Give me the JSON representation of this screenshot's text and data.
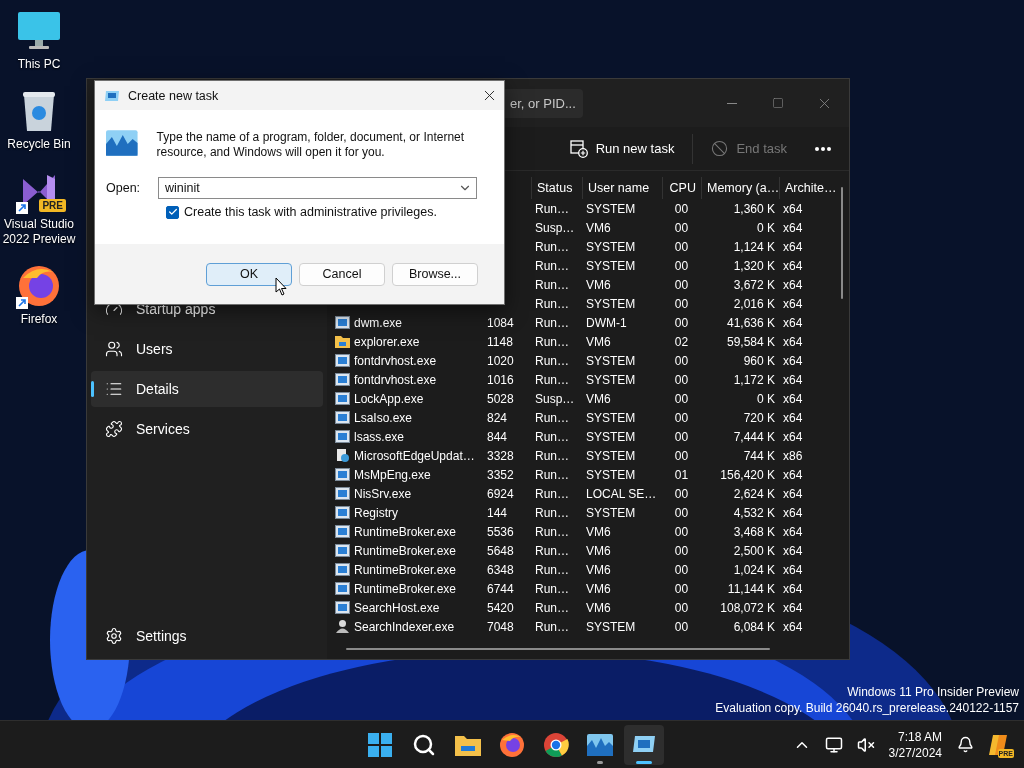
{
  "desktop": {
    "icons": [
      {
        "label": "This PC",
        "kind": "monitor"
      },
      {
        "label": "Recycle Bin",
        "kind": "bin"
      },
      {
        "label": "Visual Studio 2022 Preview",
        "kind": "vs",
        "badge": "PRE",
        "shortcut": true
      },
      {
        "label": "Firefox",
        "kind": "firefox",
        "shortcut": true
      }
    ],
    "watermark": [
      "Windows 11 Pro Insider Preview",
      "Evaluation copy. Build 26040.rs_prerelease.240122-1157"
    ]
  },
  "task_manager": {
    "search": {
      "placeholder": "er, or PID..."
    },
    "sidebar": {
      "items": [
        {
          "label": "Startup apps",
          "kind": "startup",
          "selected": false
        },
        {
          "label": "Users",
          "kind": "users",
          "selected": false
        },
        {
          "label": "Details",
          "kind": "details",
          "selected": true
        },
        {
          "label": "Services",
          "kind": "services",
          "selected": false
        }
      ],
      "footer": {
        "label": "Settings"
      }
    },
    "toolbar": [
      {
        "label": "Run new task",
        "kind": "run",
        "disabled": false
      },
      {
        "label": "End task",
        "kind": "end",
        "disabled": true
      }
    ],
    "table": {
      "columns": [
        "Status",
        "User name",
        "CPU",
        "Memory (a…",
        "Archite…"
      ],
      "rows": [
        {
          "status": "Run…",
          "user": "SYSTEM",
          "cpu": "00",
          "memory": "1,360 K",
          "arch": "x64"
        },
        {
          "status": "Susp…",
          "user": "VM6",
          "cpu": "00",
          "memory": "0 K",
          "arch": "x64"
        },
        {
          "status": "Run…",
          "user": "SYSTEM",
          "cpu": "00",
          "memory": "1,124 K",
          "arch": "x64"
        },
        {
          "status": "Run…",
          "user": "SYSTEM",
          "cpu": "00",
          "memory": "1,320 K",
          "arch": "x64"
        },
        {
          "status": "Run…",
          "user": "VM6",
          "cpu": "00",
          "memory": "3,672 K",
          "arch": "x64"
        },
        {
          "status": "Run…",
          "user": "SYSTEM",
          "cpu": "00",
          "memory": "2,016 K",
          "arch": "x64"
        },
        {
          "kind": "app",
          "name": "dwm.exe",
          "pid": "1084",
          "status": "Run…",
          "user": "DWM-1",
          "cpu": "00",
          "memory": "41,636 K",
          "arch": "x64"
        },
        {
          "kind": "folder",
          "name": "explorer.exe",
          "pid": "1148",
          "status": "Run…",
          "user": "VM6",
          "cpu": "02",
          "memory": "59,584 K",
          "arch": "x64"
        },
        {
          "kind": "app",
          "name": "fontdrvhost.exe",
          "pid": "1020",
          "status": "Run…",
          "user": "SYSTEM",
          "cpu": "00",
          "memory": "960 K",
          "arch": "x64"
        },
        {
          "kind": "app",
          "name": "fontdrvhost.exe",
          "pid": "1016",
          "status": "Run…",
          "user": "SYSTEM",
          "cpu": "00",
          "memory": "1,172 K",
          "arch": "x64"
        },
        {
          "kind": "app",
          "name": "LockApp.exe",
          "pid": "5028",
          "status": "Susp…",
          "user": "VM6",
          "cpu": "00",
          "memory": "0 K",
          "arch": "x64"
        },
        {
          "kind": "app",
          "name": "LsaIso.exe",
          "pid": "824",
          "status": "Run…",
          "user": "SYSTEM",
          "cpu": "00",
          "memory": "720 K",
          "arch": "x64"
        },
        {
          "kind": "app",
          "name": "lsass.exe",
          "pid": "844",
          "status": "Run…",
          "user": "SYSTEM",
          "cpu": "00",
          "memory": "7,444 K",
          "arch": "x64"
        },
        {
          "kind": "updater",
          "name": "MicrosoftEdgeUpdat…",
          "pid": "3328",
          "status": "Run…",
          "user": "SYSTEM",
          "cpu": "00",
          "memory": "744 K",
          "arch": "x86"
        },
        {
          "kind": "app",
          "name": "MsMpEng.exe",
          "pid": "3352",
          "status": "Run…",
          "user": "SYSTEM",
          "cpu": "01",
          "memory": "156,420 K",
          "arch": "x64"
        },
        {
          "kind": "app",
          "name": "NisSrv.exe",
          "pid": "6924",
          "status": "Run…",
          "user": "LOCAL SE…",
          "cpu": "00",
          "memory": "2,624 K",
          "arch": "x64"
        },
        {
          "kind": "app",
          "name": "Registry",
          "pid": "144",
          "status": "Run…",
          "user": "SYSTEM",
          "cpu": "00",
          "memory": "4,532 K",
          "arch": "x64"
        },
        {
          "kind": "app",
          "name": "RuntimeBroker.exe",
          "pid": "5536",
          "status": "Run…",
          "user": "VM6",
          "cpu": "00",
          "memory": "3,468 K",
          "arch": "x64"
        },
        {
          "kind": "app",
          "name": "RuntimeBroker.exe",
          "pid": "5648",
          "status": "Run…",
          "user": "VM6",
          "cpu": "00",
          "memory": "2,500 K",
          "arch": "x64"
        },
        {
          "kind": "app",
          "name": "RuntimeBroker.exe",
          "pid": "6348",
          "status": "Run…",
          "user": "VM6",
          "cpu": "00",
          "memory": "1,024 K",
          "arch": "x64"
        },
        {
          "kind": "app",
          "name": "RuntimeBroker.exe",
          "pid": "6744",
          "status": "Run…",
          "user": "VM6",
          "cpu": "00",
          "memory": "11,144 K",
          "arch": "x64"
        },
        {
          "kind": "app",
          "name": "SearchHost.exe",
          "pid": "5420",
          "status": "Run…",
          "user": "VM6",
          "cpu": "00",
          "memory": "108,072 K",
          "arch": "x64"
        },
        {
          "kind": "person",
          "name": "SearchIndexer.exe",
          "pid": "7048",
          "status": "Run…",
          "user": "SYSTEM",
          "cpu": "00",
          "memory": "6,084 K",
          "arch": "x64"
        }
      ]
    }
  },
  "dialog": {
    "title": "Create new task",
    "message": "Type the name of a program, folder, document, or Internet resource, and Windows will open it for you.",
    "open_label": "Open:",
    "value": "wininit",
    "admin": {
      "label": "Create this task with administrative privileges.",
      "checked": true
    },
    "buttons": [
      {
        "label": "OK",
        "default": true
      },
      {
        "label": "Cancel",
        "default": false
      },
      {
        "label": "Browse...",
        "default": false
      }
    ]
  },
  "taskbar": {
    "apps": [
      {
        "kind": "start",
        "running": false,
        "selected": false
      },
      {
        "kind": "search",
        "running": false,
        "selected": false
      },
      {
        "kind": "files",
        "running": false,
        "selected": false
      },
      {
        "kind": "firefox",
        "running": false,
        "selected": false
      },
      {
        "kind": "chrome",
        "running": false,
        "selected": false
      },
      {
        "kind": "taskmanager",
        "running": true,
        "selected": false
      },
      {
        "kind": "run",
        "running": true,
        "selected": true
      }
    ],
    "clock": {
      "time": "7:18 AM",
      "date": "3/27/2024"
    },
    "copilot_badge": "PRE"
  }
}
